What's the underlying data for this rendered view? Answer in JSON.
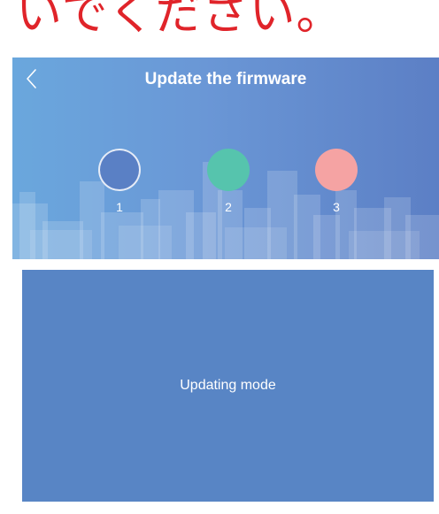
{
  "caption": {
    "text": "いでください。",
    "color": "#e0242a"
  },
  "header": {
    "back_icon": "chevron-left-icon",
    "title": "Update the firmware"
  },
  "steps": [
    {
      "number": "1",
      "color": "#5a80c5",
      "active": true
    },
    {
      "number": "2",
      "color": "#56c4ad",
      "active": false
    },
    {
      "number": "3",
      "color": "#f5a3a3",
      "active": false
    }
  ],
  "panel": {
    "text": "Updating mode",
    "color": "#5885c5"
  }
}
